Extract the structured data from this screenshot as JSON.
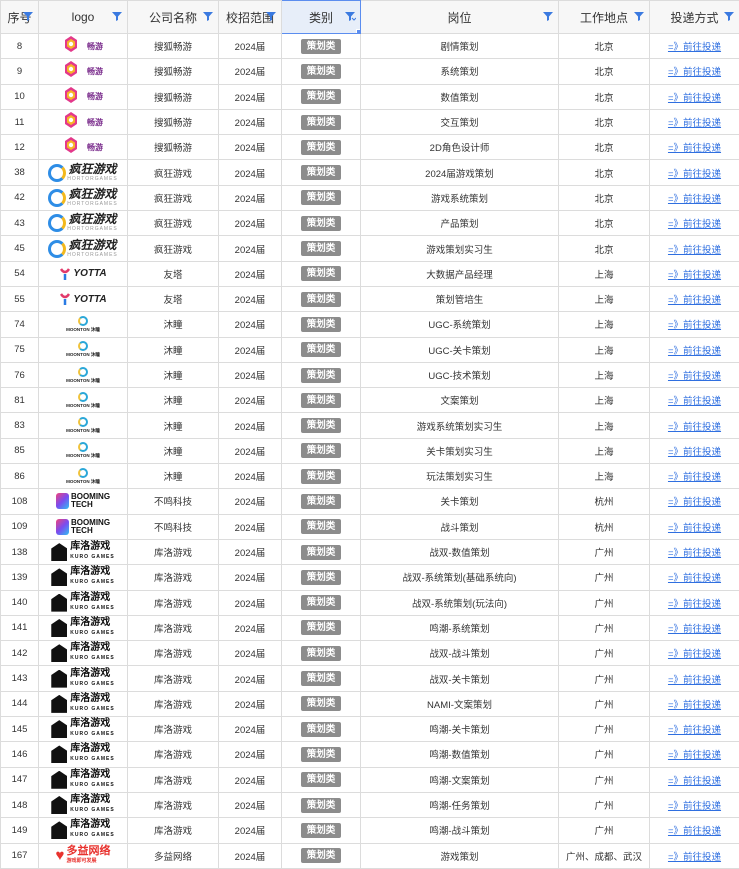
{
  "headers": {
    "idx": "序号",
    "logo": "logo",
    "company": "公司名称",
    "scope": "校招范围",
    "category": "类别",
    "position": "岗位",
    "location": "工作地点",
    "apply": "投递方式"
  },
  "tag_label": "策划类",
  "apply_link": "=》前往投递",
  "logo_texts": {
    "chang": "畅游",
    "hortor": "疯狂游戏",
    "hortor_sub": "HORTORGAMES",
    "yotta": "YOTTA",
    "moonton": "MOONTON 沐瞳",
    "booming_1": "BOOMING",
    "booming_2": "TECH",
    "kuro": "库洛游戏",
    "kuro_sub": "KURO GAMES",
    "duoyi": "多益网络",
    "duoyi_sub": "游戏即可发展"
  },
  "rows": [
    {
      "idx": "8",
      "logo": "chang",
      "company": "搜狐畅游",
      "scope": "2024届",
      "position": "剧情策划",
      "location": "北京"
    },
    {
      "idx": "9",
      "logo": "chang",
      "company": "搜狐畅游",
      "scope": "2024届",
      "position": "系统策划",
      "location": "北京"
    },
    {
      "idx": "10",
      "logo": "chang",
      "company": "搜狐畅游",
      "scope": "2024届",
      "position": "数值策划",
      "location": "北京"
    },
    {
      "idx": "11",
      "logo": "chang",
      "company": "搜狐畅游",
      "scope": "2024届",
      "position": "交互策划",
      "location": "北京"
    },
    {
      "idx": "12",
      "logo": "chang",
      "company": "搜狐畅游",
      "scope": "2024届",
      "position": "2D角色设计师",
      "location": "北京"
    },
    {
      "idx": "38",
      "logo": "hortor",
      "company": "疯狂游戏",
      "scope": "2024届",
      "position": "2024届游戏策划",
      "location": "北京"
    },
    {
      "idx": "42",
      "logo": "hortor",
      "company": "疯狂游戏",
      "scope": "2024届",
      "position": "游戏系统策划",
      "location": "北京"
    },
    {
      "idx": "43",
      "logo": "hortor",
      "company": "疯狂游戏",
      "scope": "2024届",
      "position": "产品策划",
      "location": "北京"
    },
    {
      "idx": "45",
      "logo": "hortor",
      "company": "疯狂游戏",
      "scope": "2024届",
      "position": "游戏策划实习生",
      "location": "北京"
    },
    {
      "idx": "54",
      "logo": "yotta",
      "company": "友塔",
      "scope": "2024届",
      "position": "大数据产品经理",
      "location": "上海"
    },
    {
      "idx": "55",
      "logo": "yotta",
      "company": "友塔",
      "scope": "2024届",
      "position": "策划管培生",
      "location": "上海"
    },
    {
      "idx": "74",
      "logo": "moonton",
      "company": "沐瞳",
      "scope": "2024届",
      "position": "UGC-系统策划",
      "location": "上海"
    },
    {
      "idx": "75",
      "logo": "moonton",
      "company": "沐瞳",
      "scope": "2024届",
      "position": "UGC-关卡策划",
      "location": "上海"
    },
    {
      "idx": "76",
      "logo": "moonton",
      "company": "沐瞳",
      "scope": "2024届",
      "position": "UGC-技术策划",
      "location": "上海"
    },
    {
      "idx": "81",
      "logo": "moonton",
      "company": "沐瞳",
      "scope": "2024届",
      "position": "文案策划",
      "location": "上海"
    },
    {
      "idx": "83",
      "logo": "moonton",
      "company": "沐瞳",
      "scope": "2024届",
      "position": "游戏系统策划实习生",
      "location": "上海"
    },
    {
      "idx": "85",
      "logo": "moonton",
      "company": "沐瞳",
      "scope": "2024届",
      "position": "关卡策划实习生",
      "location": "上海"
    },
    {
      "idx": "86",
      "logo": "moonton",
      "company": "沐瞳",
      "scope": "2024届",
      "position": "玩法策划实习生",
      "location": "上海"
    },
    {
      "idx": "108",
      "logo": "booming",
      "company": "不鸣科技",
      "scope": "2024届",
      "position": "关卡策划",
      "location": "杭州"
    },
    {
      "idx": "109",
      "logo": "booming",
      "company": "不鸣科技",
      "scope": "2024届",
      "position": "战斗策划",
      "location": "杭州"
    },
    {
      "idx": "138",
      "logo": "kuro",
      "company": "库洛游戏",
      "scope": "2024届",
      "position": "战双-数值策划",
      "location": "广州"
    },
    {
      "idx": "139",
      "logo": "kuro",
      "company": "库洛游戏",
      "scope": "2024届",
      "position": "战双-系统策划(基础系统向)",
      "location": "广州"
    },
    {
      "idx": "140",
      "logo": "kuro",
      "company": "库洛游戏",
      "scope": "2024届",
      "position": "战双-系统策划(玩法向)",
      "location": "广州"
    },
    {
      "idx": "141",
      "logo": "kuro",
      "company": "库洛游戏",
      "scope": "2024届",
      "position": "鸣潮-系统策划",
      "location": "广州"
    },
    {
      "idx": "142",
      "logo": "kuro",
      "company": "库洛游戏",
      "scope": "2024届",
      "position": "战双-战斗策划",
      "location": "广州"
    },
    {
      "idx": "143",
      "logo": "kuro",
      "company": "库洛游戏",
      "scope": "2024届",
      "position": "战双-关卡策划",
      "location": "广州"
    },
    {
      "idx": "144",
      "logo": "kuro",
      "company": "库洛游戏",
      "scope": "2024届",
      "position": "NAMI-文案策划",
      "location": "广州"
    },
    {
      "idx": "145",
      "logo": "kuro",
      "company": "库洛游戏",
      "scope": "2024届",
      "position": "鸣潮-关卡策划",
      "location": "广州"
    },
    {
      "idx": "146",
      "logo": "kuro",
      "company": "库洛游戏",
      "scope": "2024届",
      "position": "鸣潮-数值策划",
      "location": "广州"
    },
    {
      "idx": "147",
      "logo": "kuro",
      "company": "库洛游戏",
      "scope": "2024届",
      "position": "鸣潮-文案策划",
      "location": "广州"
    },
    {
      "idx": "148",
      "logo": "kuro",
      "company": "库洛游戏",
      "scope": "2024届",
      "position": "鸣潮-任务策划",
      "location": "广州"
    },
    {
      "idx": "149",
      "logo": "kuro",
      "company": "库洛游戏",
      "scope": "2024届",
      "position": "鸣潮-战斗策划",
      "location": "广州"
    },
    {
      "idx": "167",
      "logo": "duoyi",
      "company": "多益网络",
      "scope": "2024届",
      "position": "游戏策划",
      "location": "广州、成都、武汉"
    }
  ],
  "colors": {
    "tag_bg": "#8c8c8c",
    "link": "#2f6fe0",
    "active_header": "#5b8def"
  }
}
